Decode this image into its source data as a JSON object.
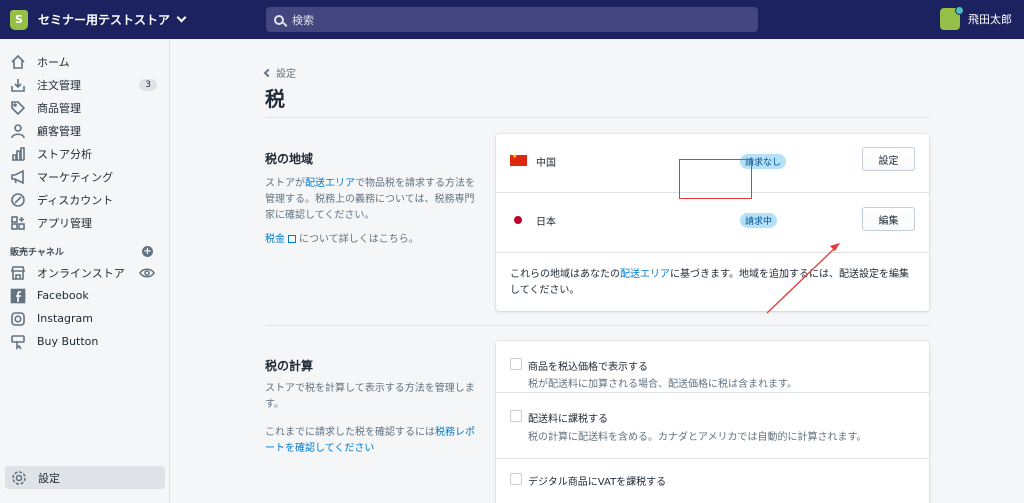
{
  "topbar": {
    "store_name": "セミナー用テストストア",
    "search_placeholder": "検索",
    "user_name": "飛田太郎"
  },
  "sidebar": {
    "items": [
      {
        "label": "ホーム",
        "icon": "home-icon"
      },
      {
        "label": "注文管理",
        "icon": "orders-icon",
        "badge": "3"
      },
      {
        "label": "商品管理",
        "icon": "tag-icon"
      },
      {
        "label": "顧客管理",
        "icon": "person-icon"
      },
      {
        "label": "ストア分析",
        "icon": "analytics-icon"
      },
      {
        "label": "マーケティング",
        "icon": "megaphone-icon"
      },
      {
        "label": "ディスカウント",
        "icon": "discount-icon"
      },
      {
        "label": "アプリ管理",
        "icon": "apps-icon"
      }
    ],
    "channels_title": "販売チャネル",
    "channels": [
      {
        "label": "オンラインストア",
        "icon": "store-icon"
      },
      {
        "label": "Facebook",
        "icon": "facebook-icon"
      },
      {
        "label": "Instagram",
        "icon": "instagram-icon"
      },
      {
        "label": "Buy Button",
        "icon": "buy-button-icon"
      }
    ],
    "settings_label": "設定"
  },
  "main": {
    "breadcrumb": "設定",
    "title": "税",
    "regions": {
      "heading": "税の地域",
      "desc_1": "ストアが",
      "desc_link": "配送エリア",
      "desc_2": "で物品税を請求する方法を管理する。税務上の義務については、税務専門家に確認してください。",
      "learn_link": "税金",
      "learn_suffix": "について詳しくはこちら。",
      "rows": [
        {
          "country": "中国",
          "status": "請求なし",
          "button": "設定"
        },
        {
          "country": "日本",
          "status": "請求中",
          "button": "編集"
        }
      ],
      "note_1": "これらの地域はあなたの",
      "note_link": "配送エリア",
      "note_2": "に基づきます。地域を追加するには、配送設定を編集してください。"
    },
    "calc": {
      "heading": "税の計算",
      "desc": "ストアで税を計算して表示する方法を管理します。",
      "desc2_1": "これまでに請求した税を確認するには",
      "desc2_link": "税務レポートを確認してください",
      "options": [
        {
          "label": "商品を税込価格で表示する",
          "help": "税が配送料に加算される場合、配送価格に税は含まれます。"
        },
        {
          "label": "配送料に課税する",
          "help": "税の計算に配送料を含める。カナダとアメリカでは自動的に計算されます。"
        },
        {
          "label": "デジタル商品にVATを課税する",
          "help": ""
        }
      ]
    }
  },
  "colors": {
    "topbar": "#1c2260",
    "accent": "#007ace",
    "annotation": "#e53935"
  }
}
